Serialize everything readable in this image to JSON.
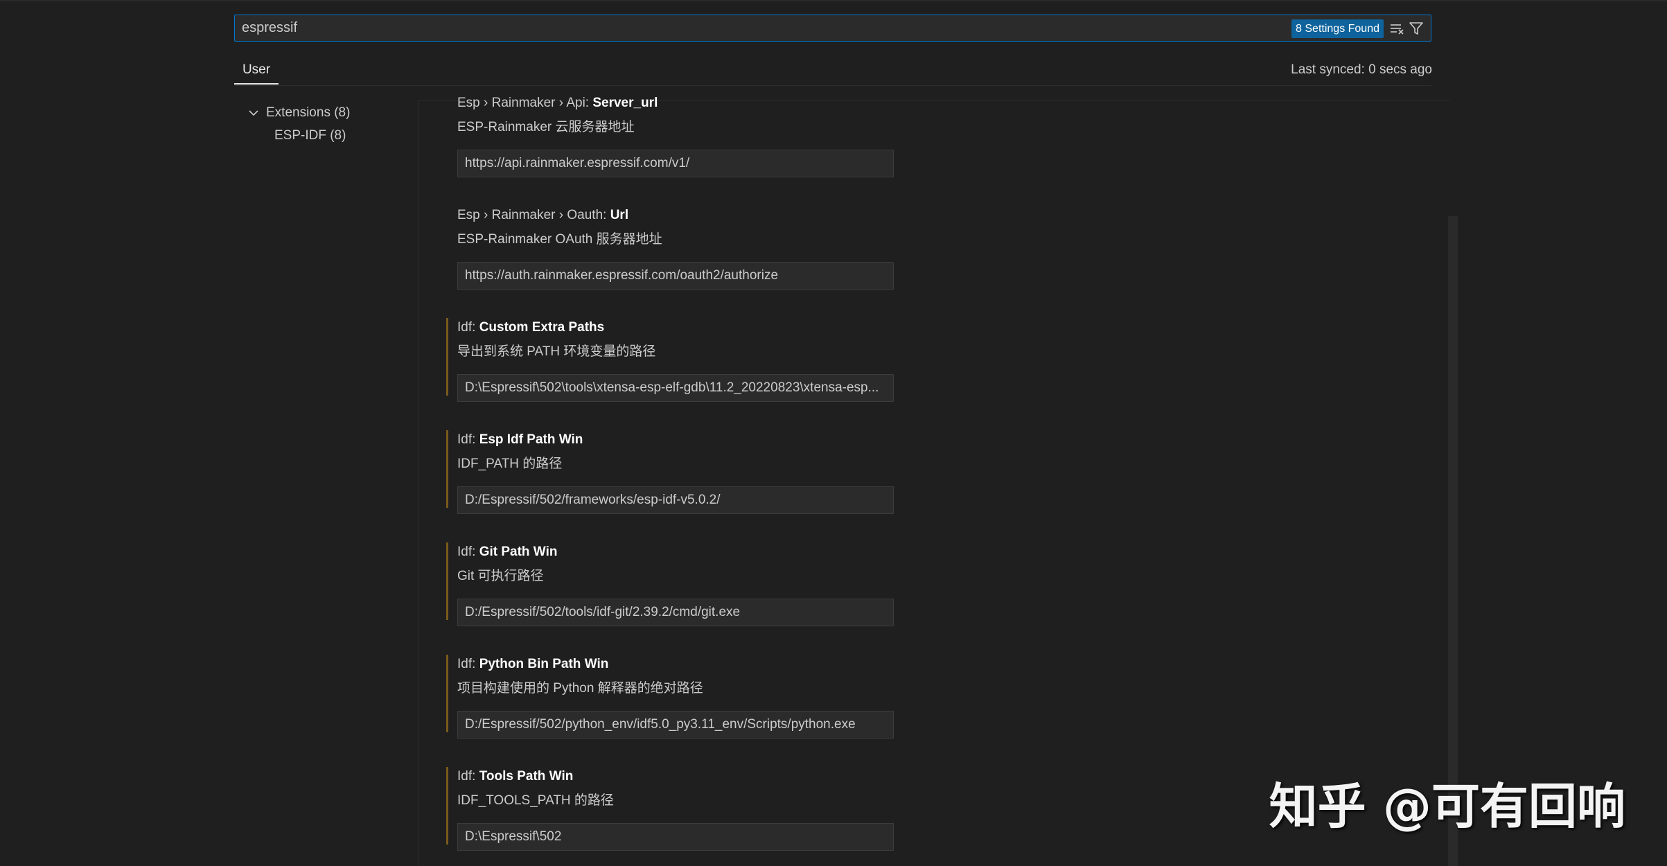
{
  "search": {
    "value": "espressif",
    "results_badge": "8 Settings Found"
  },
  "tabs": {
    "user_label": "User",
    "last_synced": "Last synced: 0 secs ago"
  },
  "toc": {
    "extensions_label": "Extensions (8)",
    "espidf_label": "ESP-IDF (8)"
  },
  "settings": [
    {
      "category": "Esp › Rainmaker › Api: ",
      "name": "Server_url",
      "description": "ESP-Rainmaker 云服务器地址",
      "value": "https://api.rainmaker.espressif.com/v1/"
    },
    {
      "category": "Esp › Rainmaker › Oauth: ",
      "name": "Url",
      "description": "ESP-Rainmaker OAuth 服务器地址",
      "value": "https://auth.rainmaker.espressif.com/oauth2/authorize"
    },
    {
      "category": "Idf: ",
      "name": "Custom Extra Paths",
      "description": "导出到系统 PATH 环境变量的路径",
      "value": "D:\\Espressif\\502\\tools\\xtensa-esp-elf-gdb\\11.2_20220823\\xtensa-esp..."
    },
    {
      "category": "Idf: ",
      "name": "Esp Idf Path Win",
      "description": "IDF_PATH 的路径",
      "value": "D:/Espressif/502/frameworks/esp-idf-v5.0.2/"
    },
    {
      "category": "Idf: ",
      "name": "Git Path Win",
      "description": "Git 可执行路径",
      "value": "D:/Espressif/502/tools/idf-git/2.39.2/cmd/git.exe"
    },
    {
      "category": "Idf: ",
      "name": "Python Bin Path Win",
      "description": "项目构建使用的 Python 解释器的绝对路径",
      "value": "D:/Espressif/502/python_env/idf5.0_py3.11_env/Scripts/python.exe"
    },
    {
      "category": "Idf: ",
      "name": "Tools Path Win",
      "description": "IDF_TOOLS_PATH 的路径",
      "value": "D:\\Espressif\\502"
    }
  ],
  "watermark": "知乎 @可有回响",
  "colors": {
    "accent": "#0078d4",
    "badge": "#0e639c",
    "modified_indicator": "#7a5a1c",
    "background": "#1f1f1f"
  }
}
